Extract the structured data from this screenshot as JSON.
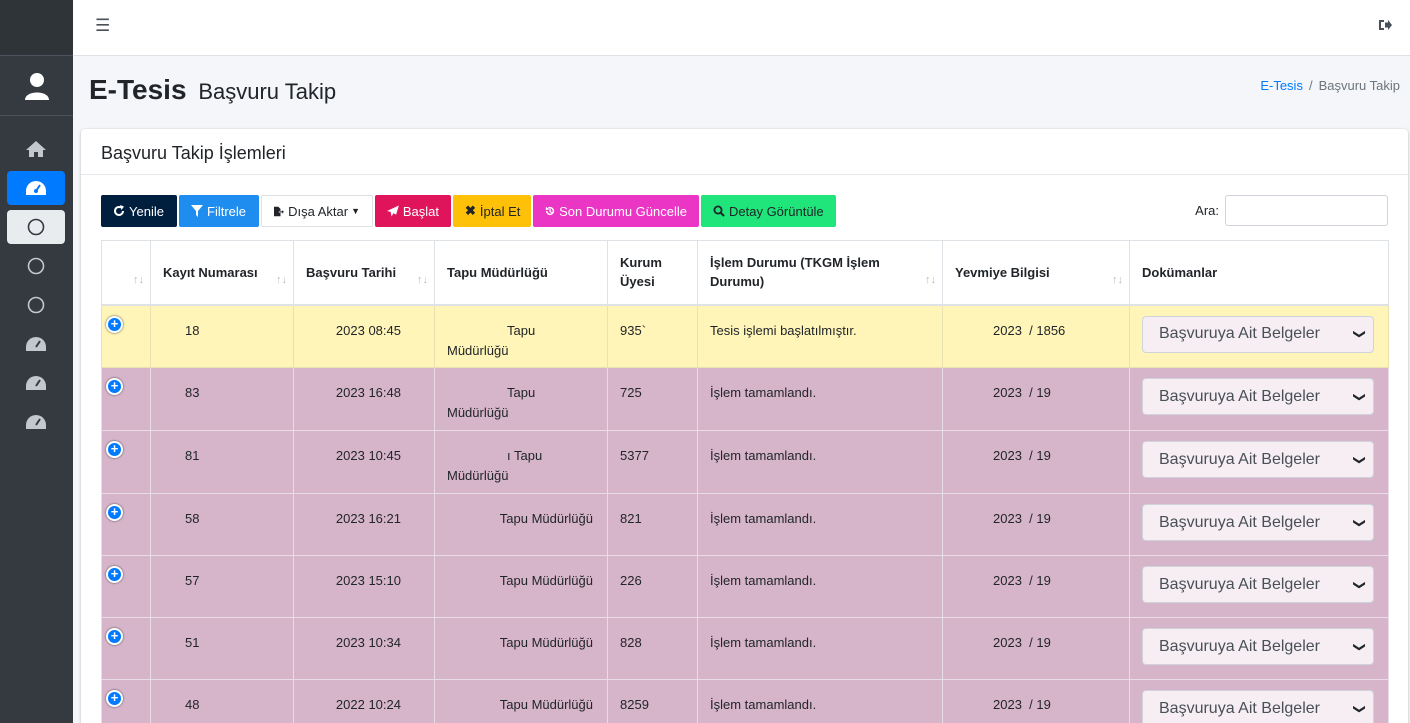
{
  "header": {
    "menu_icon": "hamburger-icon",
    "logout_icon": "sign-out-icon"
  },
  "page": {
    "title": "E-Tesis",
    "subtitle": "Başvuru Takip"
  },
  "breadcrumb": {
    "home": "E-Tesis",
    "separator": "/",
    "current": "Başvuru Takip"
  },
  "card": {
    "title": "Başvuru Takip İşlemleri"
  },
  "toolbar": {
    "yenile": "Yenile",
    "filtrele": "Filtrele",
    "disa_aktar": "Dışa Aktar",
    "baslat": "Başlat",
    "iptal": "İptal Et",
    "son_durum": "Son Durumu Güncelle",
    "detay": "Detay Görüntüle"
  },
  "search": {
    "label": "Ara:",
    "value": ""
  },
  "table": {
    "headers": [
      "",
      "Kayıt Numarası",
      "Başvuru Tarihi",
      "Tapu Müdürlüğü",
      "Kurum Üyesi",
      "İşlem Durumu (TKGM İşlem Durumu)",
      "Yevmiye Bilgisi",
      "Dokümanlar"
    ],
    "sort_glyph": "↑↓",
    "rows": [
      {
        "kayit": "18",
        "tarih": "2023 08:45",
        "tapu1": "Tapu",
        "tapu2": "Müdürlüğü",
        "kurum": "935`",
        "durum": "Tesis işlemi başlatılmıştır.",
        "yevmiye": "2023  / 1856",
        "dokuman": "Başvuruya Ait Belgeler",
        "status": "started"
      },
      {
        "kayit": "83",
        "tarih": "2023 16:48",
        "tapu1": "Tapu",
        "tapu2": "Müdürlüğü",
        "kurum": "725",
        "durum": "İşlem tamamlandı.",
        "yevmiye": "2023  / 19",
        "dokuman": "Başvuruya Ait Belgeler",
        "status": "done"
      },
      {
        "kayit": "81",
        "tarih": "2023 10:45",
        "tapu1": "ı Tapu",
        "tapu2": "Müdürlüğü",
        "kurum": "5377",
        "durum": "İşlem tamamlandı.",
        "yevmiye": "2023  / 19",
        "dokuman": "Başvuruya Ait Belgeler",
        "status": "done"
      },
      {
        "kayit": "58",
        "tarih": "2023 16:21",
        "tapu1": "Tapu Müdürlüğü",
        "tapu2": "",
        "kurum": "821",
        "durum": "İşlem tamamlandı.",
        "yevmiye": "2023  / 19",
        "dokuman": "Başvuruya Ait Belgeler",
        "status": "done"
      },
      {
        "kayit": "57",
        "tarih": "2023 15:10",
        "tapu1": "Tapu Müdürlüğü",
        "tapu2": "",
        "kurum": "226",
        "durum": "İşlem tamamlandı.",
        "yevmiye": "2023  / 19",
        "dokuman": "Başvuruya Ait Belgeler",
        "status": "done"
      },
      {
        "kayit": "51",
        "tarih": "2023 10:34",
        "tapu1": "Tapu Müdürlüğü",
        "tapu2": "",
        "kurum": "828",
        "durum": "İşlem tamamlandı.",
        "yevmiye": "2023  / 19",
        "dokuman": "Başvuruya Ait Belgeler",
        "status": "done"
      },
      {
        "kayit": "48",
        "tarih": "2022 10:24",
        "tapu1": "Tapu Müdürlüğü",
        "tapu2": "",
        "kurum": "8259",
        "durum": "İşlem tamamlandı.",
        "yevmiye": "2023  / 19",
        "dokuman": "Başvuruya Ait Belgeler",
        "status": "done"
      }
    ]
  },
  "colors": {
    "row_started": "#fff5b8",
    "row_done": "#d6b5cb",
    "accent": "#007bff"
  }
}
